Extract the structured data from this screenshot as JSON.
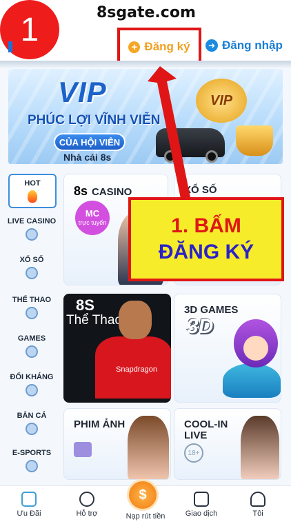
{
  "annotation": {
    "step_number": "1",
    "callout_line1": "1. BẤM",
    "callout_line2": "ĐĂNG KÝ"
  },
  "header": {
    "site": "8sgate.com",
    "register_label": "Đăng ký",
    "register_icon": "plus-circle-icon",
    "login_label": "Đăng nhập",
    "login_icon": "arrow-right-circle-icon"
  },
  "banner": {
    "vip": "VIP",
    "subtitle": "PHÚC LỢI VĨNH VIỄN",
    "pill": "CỦA HỘI VIÊN",
    "brand": "Nhà cái 8s",
    "badge": "VIP"
  },
  "sidebar": {
    "items": [
      {
        "label": "HOT",
        "icon": "fire-icon"
      },
      {
        "label": "LIVE CASINO",
        "icon": "cards-icon"
      },
      {
        "label": "XỔ SỐ",
        "icon": "lottery-ball-icon"
      },
      {
        "label": "THỂ THAO",
        "icon": "soccer-ball-icon"
      },
      {
        "label": "GAMES",
        "icon": "slot-seven-icon"
      },
      {
        "label": "ĐỐI KHÁNG",
        "icon": "versus-icon"
      },
      {
        "label": "BẮN CÁ",
        "icon": "fish-icon"
      },
      {
        "label": "E-SPORTS",
        "icon": "gamepad-icon"
      }
    ]
  },
  "cards": {
    "casino_logo": "8s",
    "casino_word": "CASINO",
    "mc_badge": "MC",
    "mc_badge_sub": "trực tuyến",
    "xoso_title": "XỔ SỐ",
    "sport_title": "8S",
    "sport_sub": "Thể Thao",
    "sport_shirt_text": "Snapdragon",
    "games_title": "3D GAMES",
    "games_art": "3D",
    "movie_title": "PHIM ẢNH",
    "cool_title": "COOL-IN",
    "cool_sub": "LIVE",
    "age": "18+"
  },
  "bottom_nav": {
    "items": [
      {
        "label": "Ưu Đãi",
        "icon": "gift-icon"
      },
      {
        "label": "Hỗ trợ",
        "icon": "support-24-icon"
      },
      {
        "label": "Nạp rút tiền",
        "icon": "dollar-coin-icon"
      },
      {
        "label": "Giao dịch",
        "icon": "receipt-icon"
      },
      {
        "label": "Tôi",
        "icon": "user-icon"
      }
    ],
    "center_glyph": "$"
  },
  "colors": {
    "accent_blue": "#1a7fd6",
    "register_orange": "#f0a020",
    "annotation_red": "#e01616",
    "annotation_yellow": "#f7ec2a",
    "annotation_blue_text": "#2a22c8"
  }
}
